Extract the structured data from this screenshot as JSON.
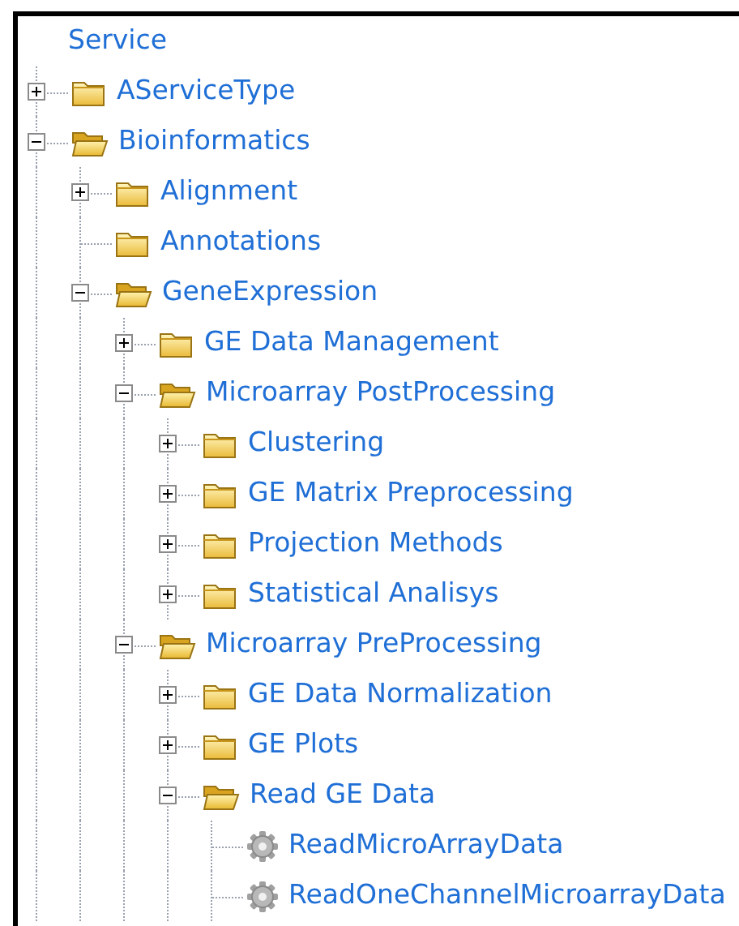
{
  "tree": {
    "label": "Service",
    "children": [
      {
        "label": "AServiceType",
        "kind": "folder",
        "expanded": false
      },
      {
        "label": "Bioinformatics",
        "kind": "folder",
        "expanded": true,
        "children": [
          {
            "label": "Alignment",
            "kind": "folder",
            "expanded": false
          },
          {
            "label": "Annotations",
            "kind": "folder"
          },
          {
            "label": "GeneExpression",
            "kind": "folder",
            "expanded": true,
            "children": [
              {
                "label": "GE Data Management",
                "kind": "folder",
                "expanded": false
              },
              {
                "label": "Microarray PostProcessing",
                "kind": "folder",
                "expanded": true,
                "children": [
                  {
                    "label": "Clustering",
                    "kind": "folder",
                    "expanded": false
                  },
                  {
                    "label": "GE Matrix Preprocessing",
                    "kind": "folder",
                    "expanded": false
                  },
                  {
                    "label": "Projection Methods",
                    "kind": "folder",
                    "expanded": false
                  },
                  {
                    "label": "Statistical Analisys",
                    "kind": "folder",
                    "expanded": false
                  }
                ]
              },
              {
                "label": "Microarray PreProcessing",
                "kind": "folder",
                "expanded": true,
                "children": [
                  {
                    "label": "GE Data Normalization",
                    "kind": "folder",
                    "expanded": false
                  },
                  {
                    "label": "GE Plots",
                    "kind": "folder",
                    "expanded": false
                  },
                  {
                    "label": "Read GE Data",
                    "kind": "folder",
                    "expanded": true,
                    "children": [
                      {
                        "label": "ReadMicroArrayData",
                        "kind": "service"
                      },
                      {
                        "label": "ReadOneChannelMicroarrayData",
                        "kind": "service"
                      }
                    ]
                  }
                ]
              }
            ]
          }
        ]
      }
    ]
  }
}
